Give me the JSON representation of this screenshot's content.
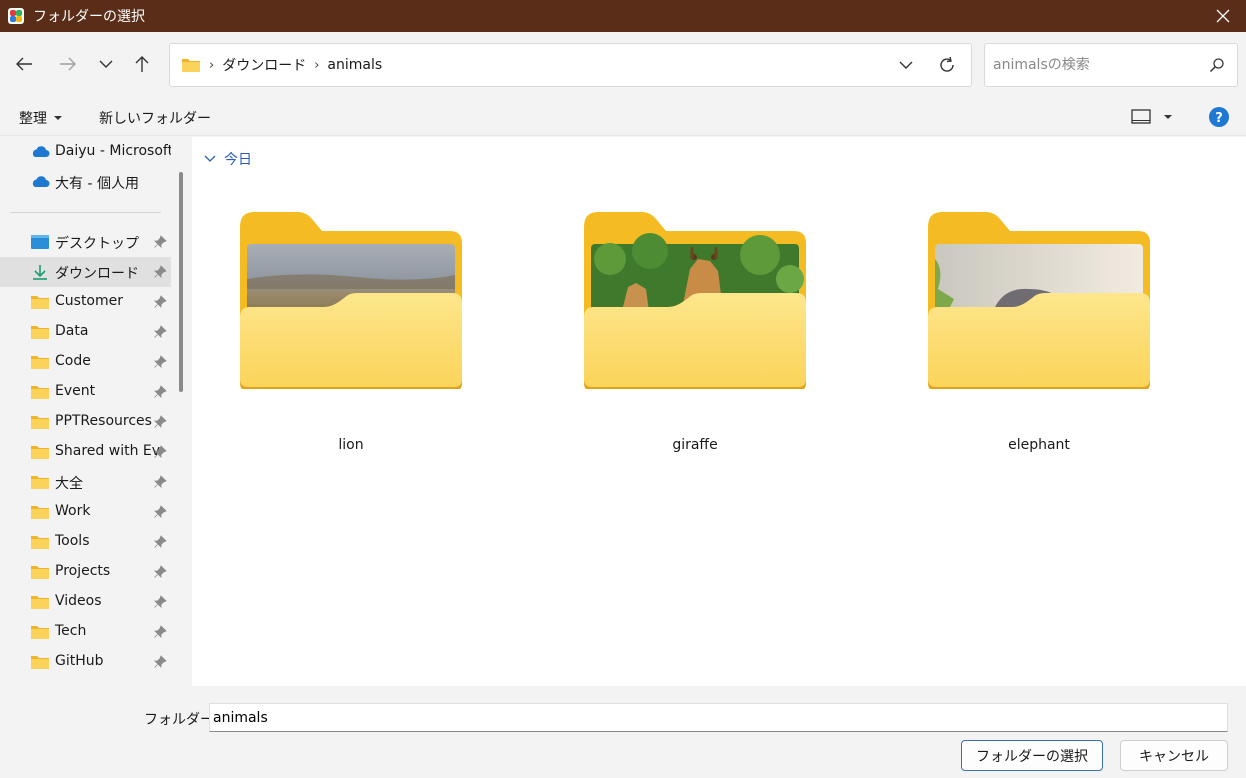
{
  "window": {
    "title": "フォルダーの選択"
  },
  "address": {
    "crumbs": [
      "ダウンロード",
      "animals"
    ]
  },
  "search": {
    "placeholder": "animalsの検索"
  },
  "toolbar": {
    "organize_label": "整理",
    "new_folder_label": "新しいフォルダー"
  },
  "sidebar": {
    "cloud": [
      {
        "label": "Daiyu - Microsoft"
      },
      {
        "label": "大有 - 個人用"
      }
    ],
    "items": [
      {
        "label": "デスクトップ",
        "icon": "desktop-icon"
      },
      {
        "label": "ダウンロード",
        "icon": "download-icon",
        "selected": true
      },
      {
        "label": "Customer",
        "icon": "folder-icon"
      },
      {
        "label": "Data",
        "icon": "folder-icon"
      },
      {
        "label": "Code",
        "icon": "folder-icon"
      },
      {
        "label": "Event",
        "icon": "folder-icon"
      },
      {
        "label": "PPTResources",
        "icon": "folder-icon"
      },
      {
        "label": "Shared with Ev",
        "icon": "folder-icon"
      },
      {
        "label": "大全",
        "icon": "folder-icon"
      },
      {
        "label": "Work",
        "icon": "folder-icon"
      },
      {
        "label": "Tools",
        "icon": "folder-icon"
      },
      {
        "label": "Projects",
        "icon": "folder-icon"
      },
      {
        "label": "Videos",
        "icon": "folder-icon"
      },
      {
        "label": "Tech",
        "icon": "folder-icon"
      },
      {
        "label": "GitHub",
        "icon": "folder-icon"
      }
    ]
  },
  "main": {
    "group_label": "今日",
    "folders": [
      {
        "name": "lion"
      },
      {
        "name": "giraffe"
      },
      {
        "name": "elephant"
      }
    ]
  },
  "footer": {
    "folder_label": "フォルダー:",
    "folder_value": "animals",
    "select_button": "フォルダーの選択",
    "cancel_button": "キャンセル"
  },
  "colors": {
    "titlebar": "#5a2d19",
    "folder": "#f5bf2b",
    "accent": "#2b5fb3"
  }
}
